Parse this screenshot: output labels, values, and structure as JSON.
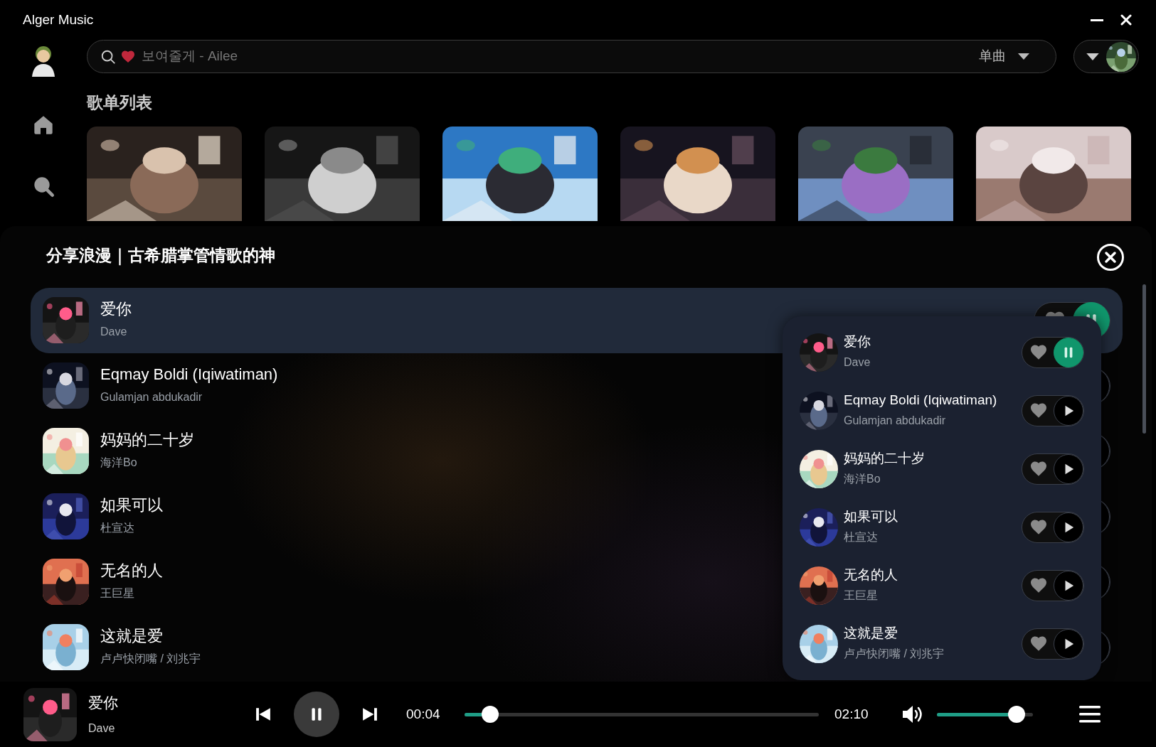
{
  "window": {
    "title": "Alger Music"
  },
  "search": {
    "placeholder": "보여줄게 - Ailee",
    "type": "单曲"
  },
  "section": {
    "title": "歌单列表"
  },
  "drawer": {
    "title": "分享浪漫｜古希腊掌管情歌的神"
  },
  "songs": [
    {
      "title": "爱你",
      "artist": "Dave",
      "selected": true,
      "playing": true
    },
    {
      "title": "Eqmay Boldi (Iqiwatiman)",
      "artist": "Gulamjan abdukadir",
      "selected": false,
      "playing": false
    },
    {
      "title": "妈妈的二十岁",
      "artist": "海洋Bo",
      "selected": false,
      "playing": false
    },
    {
      "title": "如果可以",
      "artist": "杜宣达",
      "selected": false,
      "playing": false
    },
    {
      "title": "无名的人",
      "artist": "王巨星",
      "selected": false,
      "playing": false
    },
    {
      "title": "这就是爱",
      "artist": "卢卢快闭嘴 / 刘兆宇",
      "selected": false,
      "playing": false
    }
  ],
  "queue": [
    {
      "title": "爱你",
      "artist": "Dave",
      "playing": true
    },
    {
      "title": "Eqmay Boldi (Iqiwatiman)",
      "artist": "Gulamjan abdukadir",
      "playing": false
    },
    {
      "title": "妈妈的二十岁",
      "artist": "海洋Bo",
      "playing": false
    },
    {
      "title": "如果可以",
      "artist": "杜宣达",
      "playing": false
    },
    {
      "title": "无名的人",
      "artist": "王巨星",
      "playing": false
    },
    {
      "title": "这就是爱",
      "artist": "卢卢快闭嘴 / 刘兆宇",
      "playing": false
    }
  ],
  "player": {
    "title": "爱你",
    "artist": "Dave",
    "playing": true,
    "elapsed": "00:04",
    "duration": "02:10",
    "progress": {
      "level": 0.05
    },
    "volume": {
      "level": 0.9
    }
  }
}
